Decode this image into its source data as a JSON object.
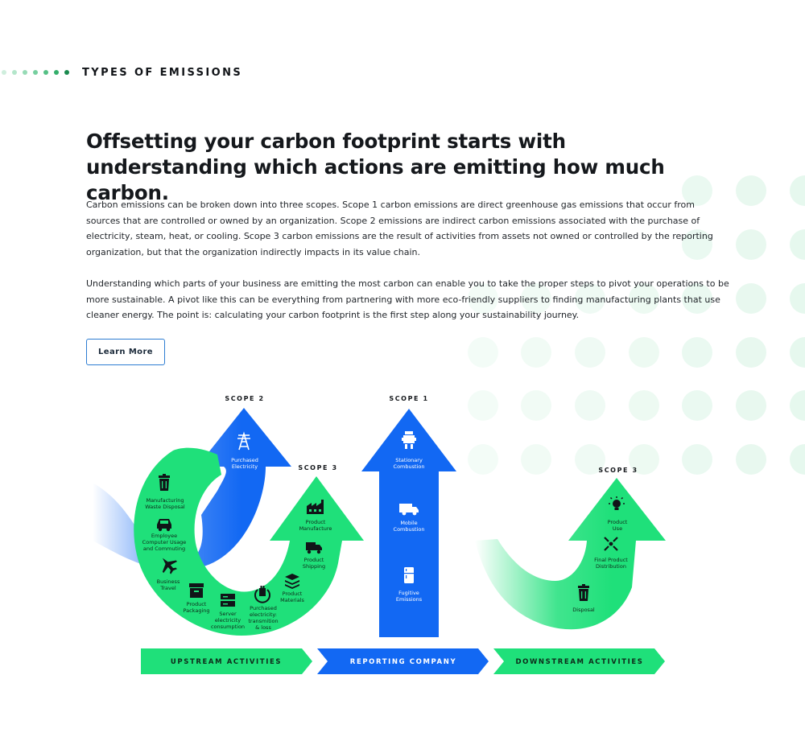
{
  "section": {
    "eyebrow": "TYPES OF EMISSIONS"
  },
  "headline": "Offsetting your carbon footprint starts with understanding which actions are emitting how much carbon.",
  "paragraphs": [
    "Carbon emissions can be broken down into three scopes. Scope 1 carbon emissions are direct greenhouse gas emissions that occur from sources that are controlled or owned by an organization. Scope 2 emissions are indirect carbon emissions associated with the purchase of electricity, steam, heat, or cooling. Scope 3 carbon emissions are the result of activities from assets not owned or controlled by the reporting organization, but that the organization indirectly impacts in its value chain.",
    "Understanding which parts of your business are emitting the most carbon can enable you to take the proper steps to pivot your operations to be more sustainable. A pivot like this can be everything from partnering with more eco-friendly suppliers to finding manufacturing plants that use cleaner energy. The point is: calculating your carbon footprint is the first step along your sustainability journey."
  ],
  "cta": {
    "label": "Learn More"
  },
  "colors": {
    "green": "#1fe07a",
    "blue": "#1268f3",
    "dark": "#111418",
    "accent": "#2d7dd2"
  },
  "diagram": {
    "scope2": {
      "title": "SCOPE 2",
      "items": [
        {
          "icon": "power-tower-icon",
          "label": "Purchased\nElectricity"
        }
      ]
    },
    "scope3_upstream": {
      "title": "SCOPE 3",
      "items": [
        {
          "icon": "trash-icon",
          "label": "Manufacturing\nWaste Disposal"
        },
        {
          "icon": "car-icon",
          "label": "Employee\nComputer Usage\nand Commuting"
        },
        {
          "icon": "airplane-icon",
          "label": "Business\nTravel"
        },
        {
          "icon": "box-icon",
          "label": "Product\nPackaging"
        },
        {
          "icon": "server-icon",
          "label": "Server\nelectricity\nconsumption"
        },
        {
          "icon": "plug-icon",
          "label": "Purchased\nelectricity:\ntransmition\n& loss"
        },
        {
          "icon": "layers-icon",
          "label": "Product\nMaterials"
        },
        {
          "icon": "truck-icon",
          "label": "Product\nShipping"
        },
        {
          "icon": "factory-icon",
          "label": "Product\nManufacture"
        }
      ]
    },
    "scope1": {
      "title": "SCOPE 1",
      "items": [
        {
          "icon": "boiler-icon",
          "label": "Stationary\nCombustion"
        },
        {
          "icon": "van-icon",
          "label": "Mobile\nCombustion"
        },
        {
          "icon": "fridge-icon",
          "label": "Fugitive\nEmissions"
        }
      ]
    },
    "scope3_downstream": {
      "title": "SCOPE 3",
      "items": [
        {
          "icon": "lightbulb-icon",
          "label": "Product\nUse"
        },
        {
          "icon": "distribution-icon",
          "label": "Final Product\nDistribution"
        },
        {
          "icon": "trash-icon",
          "label": "Disposal"
        }
      ]
    },
    "bands": [
      {
        "label": "UPSTREAM ACTIVITIES",
        "color": "#1fe07a"
      },
      {
        "label": "REPORTING COMPANY",
        "color": "#1268f3"
      },
      {
        "label": "DOWNSTREAM ACTIVITIES",
        "color": "#1fe07a"
      }
    ]
  }
}
